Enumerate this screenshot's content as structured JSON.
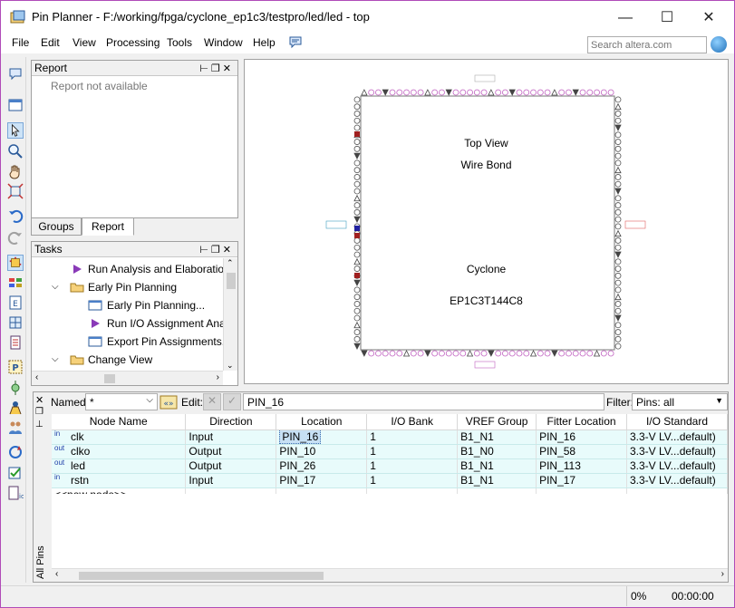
{
  "window": {
    "title": "Pin Planner - F:/working/fpga/cyclone_ep1c3/testpro/led/led - top",
    "minimize": "—",
    "maximize": "☐",
    "close": "✕"
  },
  "menu": {
    "items": [
      "File",
      "Edit",
      "View",
      "Processing",
      "Tools",
      "Window",
      "Help"
    ],
    "search_placeholder": "Search altera.com"
  },
  "report_panel": {
    "title": "Report",
    "message": "Report not available",
    "tabs": [
      "Groups",
      "Report"
    ],
    "active_tab": "Report"
  },
  "tasks_panel": {
    "title": "Tasks",
    "items": [
      {
        "label": "Run Analysis and Elaboration",
        "level": 1,
        "icon": "play-icon"
      },
      {
        "label": "Early Pin Planning",
        "level": 0,
        "icon": "folder-icon",
        "expanded": true
      },
      {
        "label": "Early Pin Planning...",
        "level": 2,
        "icon": "window-icon"
      },
      {
        "label": "Run I/O Assignment Analy",
        "level": 2,
        "icon": "play-icon"
      },
      {
        "label": "Export Pin Assignments...",
        "level": 2,
        "icon": "window-icon"
      },
      {
        "label": "Change View",
        "level": 0,
        "icon": "folder-icon",
        "expanded": true
      }
    ]
  },
  "chip_view": {
    "line1": "Top View",
    "line2": "Wire Bond",
    "family": "Cyclone",
    "device": "EP1C3T144C8"
  },
  "pin_table": {
    "named_label": "Named:",
    "named_value": "*",
    "edit_label": "Edit:",
    "edit_value": "PIN_16",
    "filter_label": "Filter:",
    "filter_value": "Pins: all",
    "side_label": "All Pins",
    "columns": [
      "Node Name",
      "Direction",
      "Location",
      "I/O Bank",
      "VREF Group",
      "Fitter Location",
      "I/O Standard"
    ],
    "rows": [
      {
        "dir_tag": "in",
        "name": "clk",
        "direction": "Input",
        "location": "PIN_16",
        "bank": "1",
        "vref": "B1_N1",
        "fitter": "PIN_16",
        "standard": "3.3-V LV...default)"
      },
      {
        "dir_tag": "out",
        "name": "clko",
        "direction": "Output",
        "location": "PIN_10",
        "bank": "1",
        "vref": "B1_N0",
        "fitter": "PIN_58",
        "standard": "3.3-V LV...default)"
      },
      {
        "dir_tag": "out",
        "name": "led",
        "direction": "Output",
        "location": "PIN_26",
        "bank": "1",
        "vref": "B1_N1",
        "fitter": "PIN_113",
        "standard": "3.3-V LV...default)"
      },
      {
        "dir_tag": "in",
        "name": "rstn",
        "direction": "Input",
        "location": "PIN_17",
        "bank": "1",
        "vref": "B1_N1",
        "fitter": "PIN_17",
        "standard": "3.3-V LV...default)"
      }
    ],
    "new_node": "<<new node>>"
  },
  "status": {
    "progress": "0%",
    "time": "00:00:00"
  },
  "colors": {
    "frame": "#b04bb8",
    "pin_row": "#e8fbfb",
    "selection": "#c7e0f4",
    "chip_pin_top": "#c060c0"
  }
}
